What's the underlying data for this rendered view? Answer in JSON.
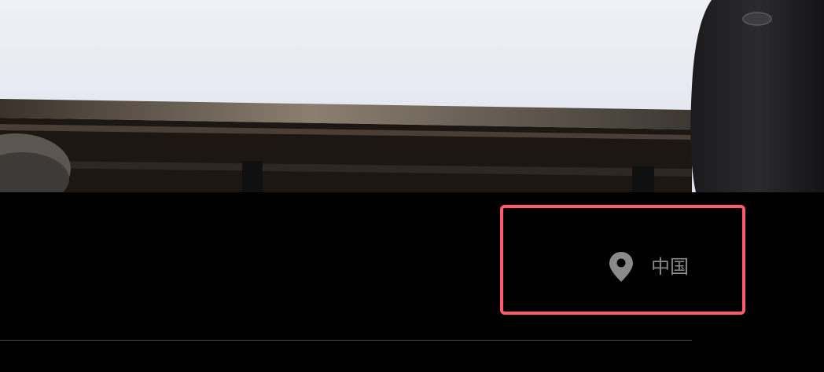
{
  "location": {
    "icon": "location-pin-icon",
    "text": "中国"
  },
  "colors": {
    "background": "#000000",
    "highlight_border": "#ff5a6e",
    "location_text": "#8a8a8a",
    "divider": "#4a4a4a"
  }
}
